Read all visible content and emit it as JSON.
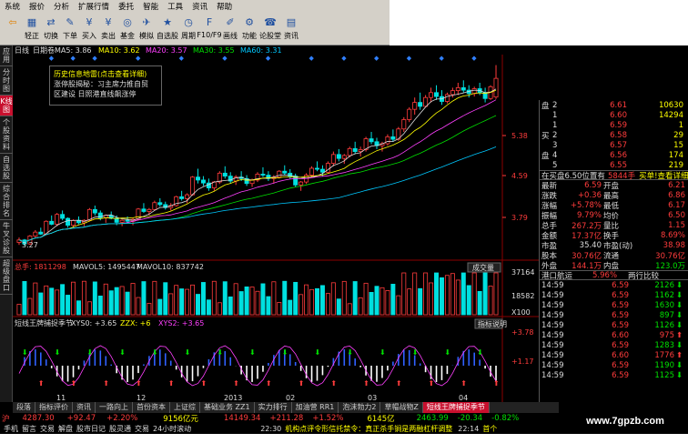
{
  "menu": [
    "系统",
    "报价",
    "分析",
    "扩展行情",
    "委托",
    "智能",
    "工具",
    "资讯",
    "帮助"
  ],
  "toolbar": [
    {
      "icon": "back-icon",
      "label": ""
    },
    {
      "icon": "chart-icon",
      "label": "轻正"
    },
    {
      "icon": "switch-icon",
      "label": "切换"
    },
    {
      "icon": "order-icon",
      "label": "下单"
    },
    {
      "icon": "sell-icon",
      "label": "买入"
    },
    {
      "icon": "sell-icon",
      "label": "卖出"
    },
    {
      "icon": "fund-icon",
      "label": "基金"
    },
    {
      "icon": "simulate-icon",
      "label": "模拟"
    },
    {
      "icon": "portfolio-icon",
      "label": "自选股"
    },
    {
      "icon": "period-icon",
      "label": "周期"
    },
    {
      "icon": "f10-icon",
      "label": "F10/F9"
    },
    {
      "icon": "draw-icon",
      "label": "画线"
    },
    {
      "icon": "function-icon",
      "label": "功能"
    },
    {
      "icon": "forum-icon",
      "label": "论股堂"
    },
    {
      "icon": "news-icon",
      "label": "资讯"
    }
  ],
  "left_tabs": [
    "应用",
    "分时图",
    "K线图",
    "个股资料",
    "自选股",
    "综合排名",
    "牛叉诊股",
    "超级盘口"
  ],
  "chart_header": {
    "period": "日线",
    "mode": "日期卷",
    "ma5": "MA5: 3.86",
    "ma10": "MA10: 3.62",
    "ma20": "MA20: 3.57",
    "ma30": "MA30: 3.55",
    "ma60": "MA60: 3.31"
  },
  "popup": {
    "title": "历史信息地雷(点击查看详细)",
    "line1": "涨停股揭秘：习主席力推自贸",
    "line2": "区建设 日照港直线飙涨停"
  },
  "price_axis": [
    "5.38",
    "4.59",
    "3.79"
  ],
  "low_label": "3.27",
  "volume_header": {
    "label": "总手: 1811298",
    "mavol5": "MAVOL5: 1495447",
    "mavol10": "MAVOL10: 837742",
    "selector": "成交量"
  },
  "volume_axis": [
    "37164",
    "18582",
    "X100"
  ],
  "indicator_header": {
    "name": "短线王牌捕捉季节",
    "xys0": "XYS0: +3.65",
    "zzx": "ZZX: +6",
    "xys2": "XYS2: +3.65",
    "help": "指标说明"
  },
  "indicator_axis": [
    "+3.78",
    "+1.17"
  ],
  "date_labels": [
    "11",
    "12",
    "2013",
    "02",
    "03",
    "04"
  ],
  "orderbook": [
    {
      "side": "盘",
      "level": "2",
      "price": "6.61",
      "vol": "10630"
    },
    {
      "side": "",
      "level": "1",
      "price": "6.60",
      "vol": "14294"
    },
    {
      "side": "",
      "level": "1",
      "price": "6.59",
      "vol": "1"
    },
    {
      "side": "买",
      "level": "2",
      "price": "6.58",
      "vol": "29"
    },
    {
      "side": "",
      "level": "3",
      "price": "6.57",
      "vol": "15"
    },
    {
      "side": "盘",
      "level": "4",
      "price": "6.56",
      "vol": "174"
    },
    {
      "side": "",
      "level": "5",
      "price": "6.55",
      "vol": "219"
    }
  ],
  "quote_notice": {
    "left": "在买盘6.50位置有",
    "right": "5844手",
    "tag": "买单!查看详细"
  },
  "stats": [
    {
      "k1": "最新",
      "v1": "6.59",
      "k2": "开盘",
      "v2": "6.21"
    },
    {
      "k1": "涨跌",
      "v1": "+0.36",
      "k2": "最高",
      "v2": "6.86"
    },
    {
      "k1": "涨幅",
      "v1": "+5.78%",
      "k2": "最低",
      "v2": "6.17"
    },
    {
      "k1": "振幅",
      "v1": "9.79%",
      "k2": "均价",
      "v2": "6.50"
    },
    {
      "k1": "总手",
      "v1": "267.2万",
      "k2": "量比",
      "v2": "1.15"
    },
    {
      "k1": "金额",
      "v1": "17.37亿",
      "k2": "换手",
      "v2": "8.69%"
    },
    {
      "k1": "市盈",
      "v1": "35.40",
      "k2": "市盈(动)",
      "v2": "38.98"
    },
    {
      "k1": "股本",
      "v1": "30.76亿",
      "k2": "流通",
      "v2": "30.76亿"
    },
    {
      "k1": "外盘",
      "v1": "144.1万",
      "k2": "内盘",
      "v2": "123.0万"
    }
  ],
  "ticks_header": {
    "left": "港口航运",
    "mid": "5.96%",
    "right": "两行比较"
  },
  "ticks": [
    {
      "t": "14:59",
      "p": "6.59",
      "v": "2126",
      "d": "down"
    },
    {
      "t": "14:59",
      "p": "6.59",
      "v": "1162",
      "d": "down"
    },
    {
      "t": "14:59",
      "p": "6.59",
      "v": "1630",
      "d": "down"
    },
    {
      "t": "14:59",
      "p": "6.59",
      "v": "897",
      "d": "down"
    },
    {
      "t": "14:59",
      "p": "6.59",
      "v": "1126",
      "d": "down"
    },
    {
      "t": "14:59",
      "p": "6.60",
      "v": "975",
      "d": "up"
    },
    {
      "t": "14:59",
      "p": "6.59",
      "v": "1283",
      "d": "down"
    },
    {
      "t": "14:59",
      "p": "6.60",
      "v": "1776",
      "d": "up"
    },
    {
      "t": "14:59",
      "p": "6.59",
      "v": "1190",
      "d": "down"
    },
    {
      "t": "14:59",
      "p": "6.59",
      "v": "1125",
      "d": "down"
    }
  ],
  "bottom_tabs": [
    "段落",
    "指标评价",
    "资讯",
    "一路向上",
    "首份资本",
    "上证综",
    "基础业务 ZZ1",
    "实力排行",
    "加油营 RR1",
    "泡沫勃力2",
    "草帽战物Z",
    "短线王牌捕捉季节"
  ],
  "status": {
    "market": "沪",
    "index": "4287.30",
    "change": "+92.47",
    "pct": "+2.20%",
    "amount": "9156亿元",
    "sz_index": "14149.34",
    "sz_change": "+211.28",
    "sz_pct": "+1.52%",
    "sz_amount": "6145亿",
    "cyb": "2463.99",
    "cyb_change": "-20.34",
    "cyb_pct": "-0.82%"
  },
  "status2": {
    "items": [
      "手机",
      "留言",
      "交易",
      "解盘",
      "股市日记",
      "股灵通",
      "交易",
      "24小时滚动"
    ],
    "time1": "22:30",
    "news1": "机构点评令形信托禁令：真正杀手锏是两融杠杆调整",
    "time2": "22:14",
    "news2": "首个"
  },
  "watermark": "www.7gpzb.com",
  "colors": {
    "up": "#ff3c3c",
    "down": "#00e000",
    "bg": "#000000",
    "accent": "#c8102e"
  },
  "candles": [
    [
      3.25,
      3.35,
      3.2,
      3.3
    ],
    [
      3.3,
      3.32,
      3.18,
      3.22
    ],
    [
      3.22,
      3.4,
      3.2,
      3.38
    ],
    [
      3.38,
      3.5,
      3.33,
      3.46
    ],
    [
      3.46,
      3.55,
      3.4,
      3.42
    ],
    [
      3.42,
      3.7,
      3.4,
      3.68
    ],
    [
      3.68,
      3.8,
      3.6,
      3.62
    ],
    [
      3.62,
      3.85,
      3.58,
      3.82
    ],
    [
      3.82,
      3.9,
      3.7,
      3.74
    ],
    [
      3.74,
      3.76,
      3.55,
      3.6
    ],
    [
      3.6,
      3.72,
      3.55,
      3.7
    ],
    [
      3.7,
      3.78,
      3.62,
      3.65
    ],
    [
      3.65,
      3.72,
      3.58,
      3.7
    ],
    [
      3.7,
      3.95,
      3.68,
      3.92
    ],
    [
      3.92,
      4.0,
      3.8,
      3.85
    ],
    [
      3.85,
      3.9,
      3.7,
      3.75
    ],
    [
      3.75,
      3.82,
      3.65,
      3.8
    ],
    [
      3.8,
      3.88,
      3.72,
      3.74
    ],
    [
      3.74,
      3.8,
      3.6,
      3.66
    ],
    [
      3.66,
      3.72,
      3.58,
      3.7
    ],
    [
      3.7,
      3.78,
      3.64,
      3.68
    ],
    [
      3.68,
      3.75,
      3.6,
      3.72
    ],
    [
      3.72,
      3.95,
      3.7,
      3.93
    ],
    [
      3.93,
      4.05,
      3.85,
      3.88
    ],
    [
      3.88,
      3.95,
      3.8,
      3.92
    ],
    [
      3.92,
      4.1,
      3.9,
      4.06
    ],
    [
      4.06,
      4.15,
      3.98,
      4.02
    ],
    [
      4.02,
      4.08,
      3.92,
      3.96
    ],
    [
      3.96,
      4.05,
      3.9,
      4.0
    ],
    [
      4.0,
      4.2,
      3.98,
      4.18
    ],
    [
      4.18,
      4.3,
      4.1,
      4.14
    ],
    [
      4.14,
      4.25,
      4.05,
      4.22
    ],
    [
      4.22,
      4.6,
      4.2,
      4.58
    ],
    [
      4.58,
      4.75,
      4.45,
      4.52
    ],
    [
      4.52,
      4.6,
      4.4,
      4.46
    ],
    [
      4.46,
      4.55,
      4.3,
      4.36
    ],
    [
      4.36,
      4.5,
      4.3,
      4.48
    ],
    [
      4.48,
      4.7,
      4.44,
      4.66
    ],
    [
      4.66,
      4.8,
      4.55,
      4.6
    ],
    [
      4.6,
      4.68,
      4.45,
      4.5
    ],
    [
      4.5,
      4.62,
      4.42,
      4.58
    ],
    [
      4.58,
      4.7,
      4.5,
      4.55
    ],
    [
      4.55,
      4.62,
      4.4,
      4.45
    ],
    [
      4.45,
      4.55,
      4.38,
      4.52
    ],
    [
      4.52,
      4.68,
      4.48,
      4.64
    ],
    [
      4.64,
      4.78,
      4.58,
      4.62
    ],
    [
      4.62,
      4.7,
      4.5,
      4.55
    ],
    [
      4.55,
      4.62,
      4.45,
      4.58
    ],
    [
      4.58,
      4.72,
      4.55,
      4.7
    ],
    [
      4.7,
      4.82,
      4.62,
      4.66
    ],
    [
      4.66,
      4.74,
      4.55,
      4.6
    ],
    [
      4.6,
      4.65,
      4.38,
      4.42
    ],
    [
      4.42,
      4.5,
      4.3,
      4.48
    ],
    [
      4.48,
      4.66,
      4.44,
      4.62
    ],
    [
      4.62,
      4.8,
      4.58,
      4.76
    ],
    [
      4.76,
      4.9,
      4.7,
      4.74
    ],
    [
      4.74,
      4.82,
      4.6,
      4.68
    ],
    [
      4.68,
      4.9,
      4.65,
      4.86
    ],
    [
      4.86,
      5.1,
      4.8,
      5.04
    ],
    [
      5.04,
      5.15,
      4.9,
      4.96
    ],
    [
      4.96,
      5.05,
      4.85,
      5.02
    ],
    [
      5.02,
      5.2,
      4.98,
      5.16
    ],
    [
      5.16,
      5.3,
      5.05,
      5.1
    ],
    [
      5.1,
      5.2,
      5.0,
      5.14
    ],
    [
      5.14,
      5.4,
      5.1,
      5.36
    ],
    [
      5.36,
      5.5,
      5.25,
      5.3
    ],
    [
      5.3,
      5.38,
      5.15,
      5.22
    ],
    [
      5.22,
      5.3,
      5.1,
      5.26
    ],
    [
      5.26,
      5.45,
      5.22,
      5.4
    ],
    [
      5.4,
      5.55,
      5.3,
      5.35
    ],
    [
      5.35,
      5.6,
      5.32,
      5.56
    ],
    [
      5.56,
      5.8,
      5.5,
      5.75
    ],
    [
      5.75,
      6.0,
      5.7,
      5.96
    ],
    [
      5.96,
      6.2,
      5.85,
      6.1
    ],
    [
      6.1,
      6.3,
      5.95,
      6.02
    ],
    [
      6.02,
      6.25,
      6.0,
      6.2
    ],
    [
      6.2,
      6.4,
      6.1,
      6.3
    ],
    [
      6.3,
      6.45,
      6.15,
      6.22
    ],
    [
      6.22,
      6.35,
      6.05,
      6.12
    ],
    [
      6.12,
      6.3,
      6.08,
      6.26
    ],
    [
      6.26,
      6.4,
      6.2,
      6.34
    ],
    [
      6.34,
      6.5,
      6.25,
      6.4
    ],
    [
      6.4,
      6.55,
      6.3,
      6.35
    ],
    [
      6.35,
      6.45,
      6.2,
      6.28
    ],
    [
      6.28,
      6.42,
      6.22,
      6.38
    ],
    [
      6.38,
      6.5,
      6.25,
      6.3
    ],
    [
      6.3,
      6.4,
      6.1,
      6.18
    ],
    [
      6.18,
      6.45,
      6.15,
      6.42
    ],
    [
      6.21,
      6.86,
      6.17,
      6.59
    ]
  ]
}
